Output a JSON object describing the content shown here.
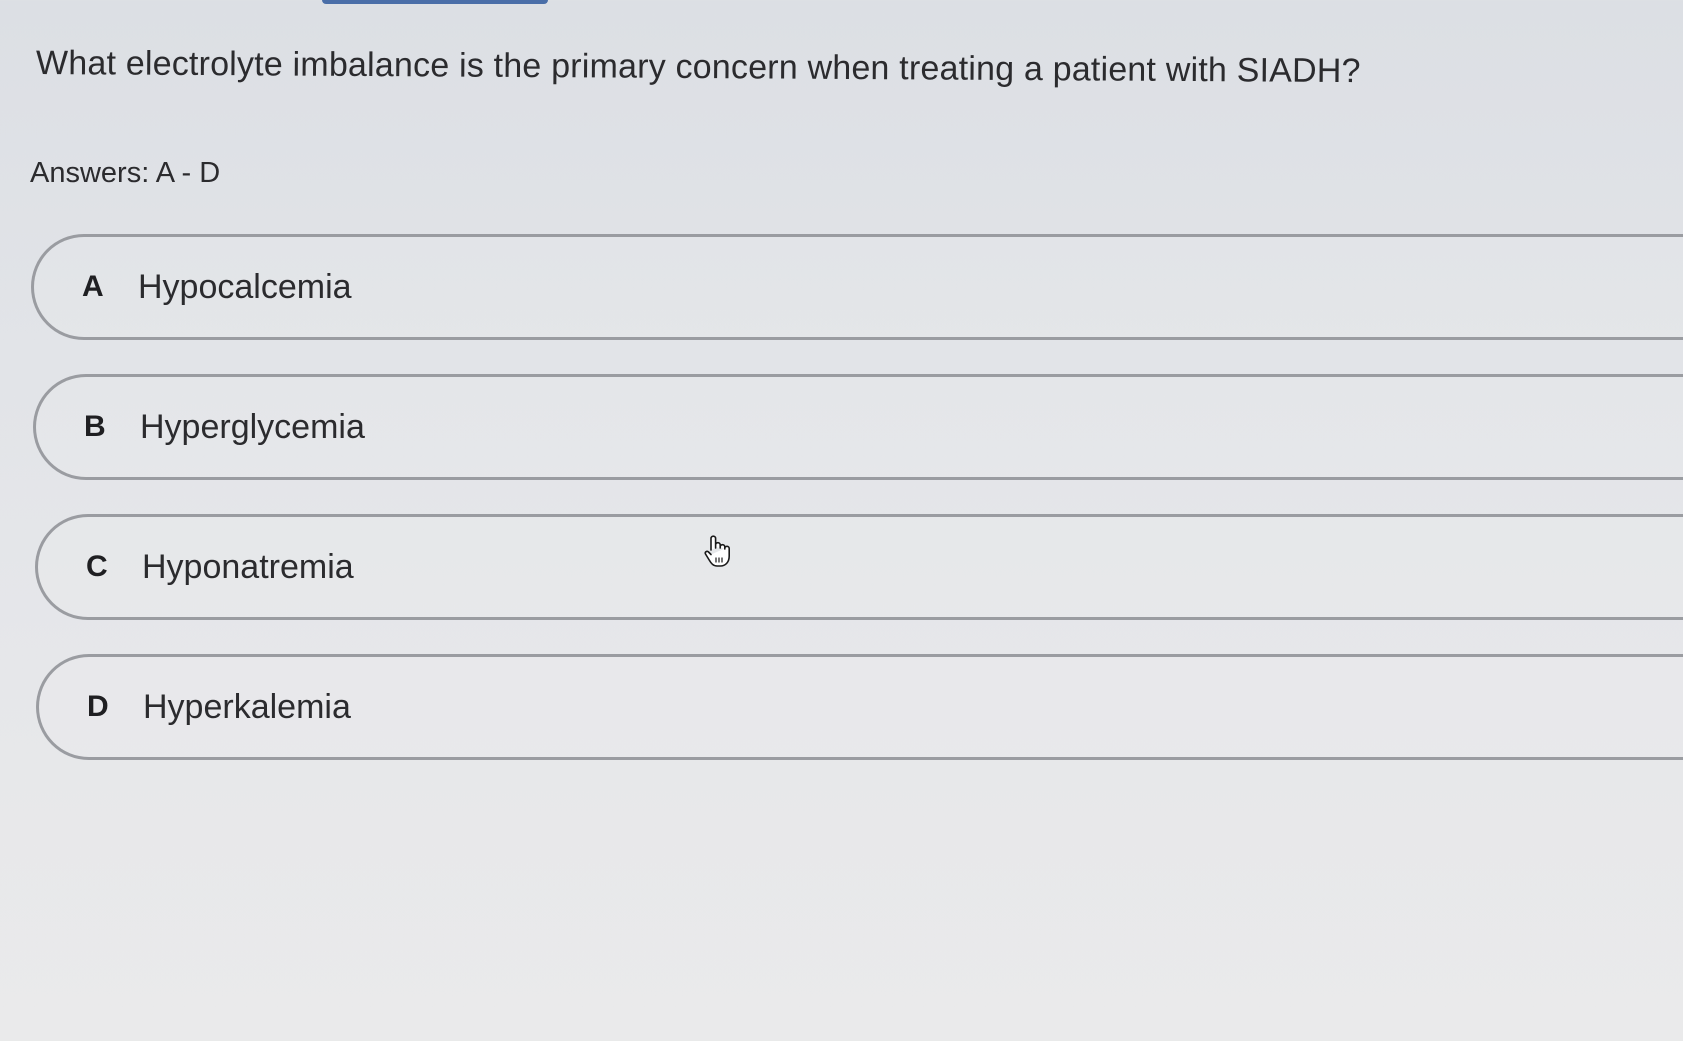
{
  "question": {
    "text": "What electrolyte imbalance is the primary concern when treating a patient with SIADH?"
  },
  "answers_label": "Answers: A - D",
  "options": [
    {
      "letter": "A",
      "text": "Hypocalcemia"
    },
    {
      "letter": "B",
      "text": "Hyperglycemia"
    },
    {
      "letter": "C",
      "text": "Hyponatremia"
    },
    {
      "letter": "D",
      "text": "Hyperkalemia"
    }
  ],
  "cursor": {
    "icon": "hand-pointer-icon"
  },
  "colors": {
    "accent": "#4a6ea8",
    "option_border": "#9a9ca1",
    "text": "#2b2b2e"
  }
}
